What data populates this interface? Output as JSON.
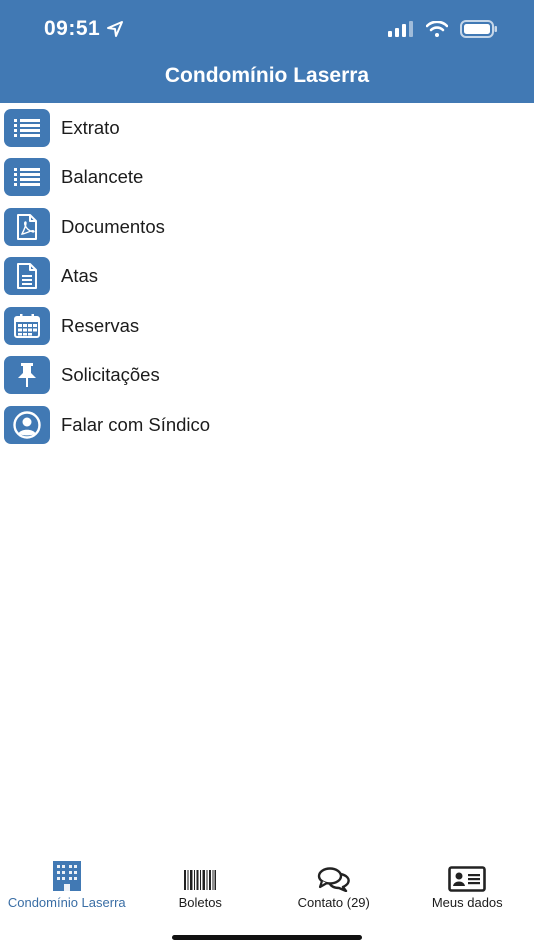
{
  "status_bar": {
    "time": "09:51"
  },
  "header": {
    "title": "Condomínio Laserra"
  },
  "menu": {
    "items": [
      {
        "label": "Extrato",
        "icon": "list-icon"
      },
      {
        "label": "Balancete",
        "icon": "list-icon"
      },
      {
        "label": "Documentos",
        "icon": "pdf-icon"
      },
      {
        "label": "Atas",
        "icon": "document-icon"
      },
      {
        "label": "Reservas",
        "icon": "calendar-icon"
      },
      {
        "label": "Solicitações",
        "icon": "pin-icon"
      },
      {
        "label": "Falar com Síndico",
        "icon": "user-circle-icon"
      }
    ]
  },
  "tabbar": {
    "active": "Condomínio Laserra",
    "tabs": [
      {
        "label": "Condomínio Laserra",
        "icon": "building-icon"
      },
      {
        "label": "Boletos",
        "icon": "barcode-icon"
      },
      {
        "label": "Contato (29)",
        "icon": "chat-icon"
      },
      {
        "label": "Meus dados",
        "icon": "id-card-icon"
      }
    ]
  },
  "colors": {
    "brand": "#4179b4",
    "active_tab": "#3a6ea5"
  }
}
